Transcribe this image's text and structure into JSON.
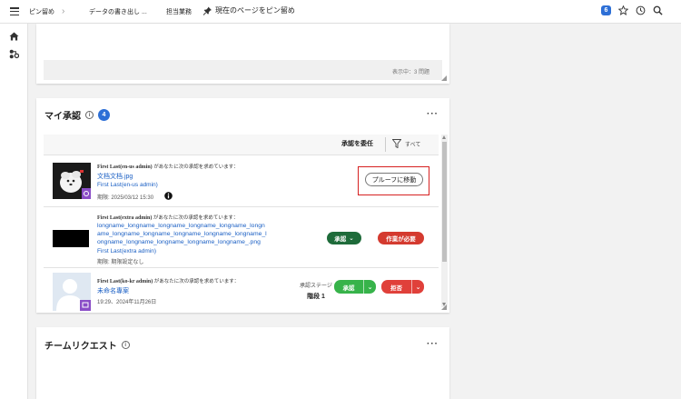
{
  "topbar": {
    "tab_pin": "ピン留め",
    "tab_export": "データの書き出し ...",
    "tab_tasks": "担当業務",
    "pin_page": "現在のページをピン留め",
    "notif_count": "6"
  },
  "top_card": {
    "showing": "表示中：3 問題"
  },
  "approvals": {
    "title": "マイ承認",
    "count": "4",
    "delegate_label": "承認を委任",
    "filter_label": "すべて",
    "rows": [
      {
        "requester_name": "First Last(en-us admin)",
        "requester_suffix": "があなたに次の承認を求めています：",
        "file": "文档文档.jpg",
        "owner": "First Last(en-us admin)",
        "due": "期限: 2025/03/12 15:30",
        "button": "プルーフに移動"
      },
      {
        "requester_name": "First Last(extra admin)",
        "requester_suffix": "があなたに次の承認を求めています：",
        "file_line1": "longname_longname_longname_longname_longname_longn",
        "file_line2": "ame_longname_longname_longname_longname_longname_l",
        "file_line3": "ongname_longname_longname_longname_longname_.png",
        "owner": "First Last(extra admin)",
        "due": "期限: 期限設定なし",
        "approve": "承認",
        "work_required": "作業が必要"
      },
      {
        "requester_name": "First Last(ko-kr admin)",
        "requester_suffix": "があなたに次の承認を求めています：",
        "file": "未命名專案",
        "date": "19:29、2024年11月26日",
        "stage_label": "承認ステージ",
        "stage_value": "階段 1",
        "approve": "承認",
        "reject": "拒否"
      }
    ]
  },
  "team_requests": {
    "title": "チームリクエスト"
  },
  "colors": {
    "accent_blue": "#2d6fd6",
    "link": "#1a5fc4",
    "approve_dark": "#1e6b3a",
    "approve_green": "#37b34a",
    "reject_red": "#e0403a",
    "highlight_red": "#d62020"
  }
}
